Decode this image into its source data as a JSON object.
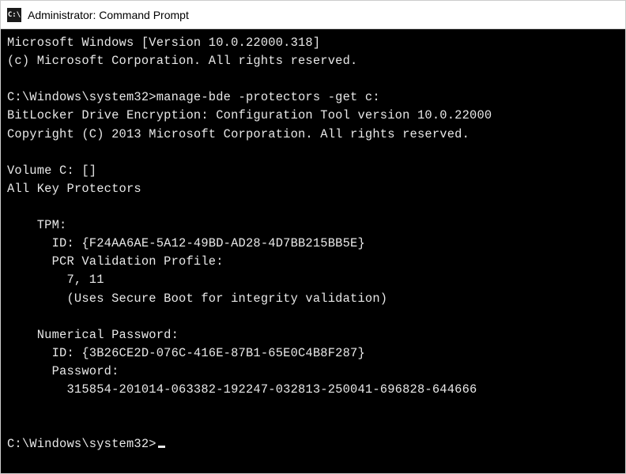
{
  "window": {
    "title": "Administrator: Command Prompt",
    "icon_glyph": "C:\\"
  },
  "terminal": {
    "header_version": "Microsoft Windows [Version 10.0.22000.318]",
    "header_copyright": "(c) Microsoft Corporation. All rights reserved.",
    "prompt1_path": "C:\\Windows\\system32>",
    "prompt1_cmd": "manage-bde -protectors -get c:",
    "tool_line1": "BitLocker Drive Encryption: Configuration Tool version 10.0.22000",
    "tool_line2": "Copyright (C) 2013 Microsoft Corporation. All rights reserved.",
    "volume_line": "Volume C: []",
    "protectors_line": "All Key Protectors",
    "tpm_label": "    TPM:",
    "tpm_id": "      ID: {F24AA6AE-5A12-49BD-AD28-4D7BB215BB5E}",
    "tpm_pcr_label": "      PCR Validation Profile:",
    "tpm_pcr_values": "        7, 11",
    "tpm_pcr_note": "        (Uses Secure Boot for integrity validation)",
    "numpw_label": "    Numerical Password:",
    "numpw_id": "      ID: {3B26CE2D-076C-416E-87B1-65E0C4B8F287}",
    "numpw_pw_label": "      Password:",
    "numpw_pw_value": "        315854-201014-063382-192247-032813-250041-696828-644666",
    "prompt2_path": "C:\\Windows\\system32>"
  }
}
